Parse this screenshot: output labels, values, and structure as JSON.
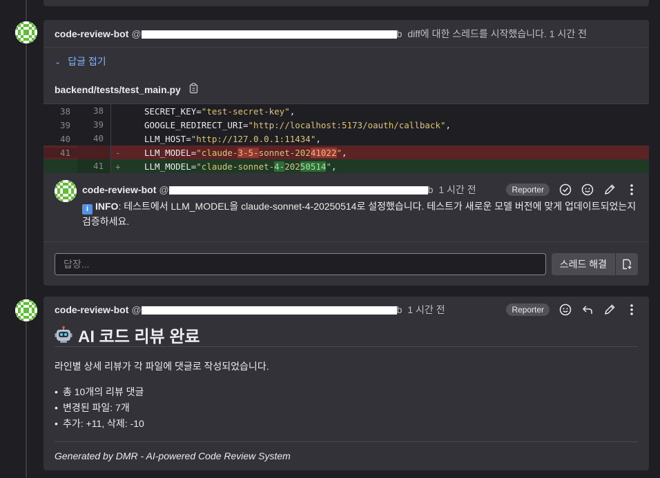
{
  "thread": {
    "author": "code-review-bot",
    "handle_prefix": "@",
    "handle_suffix": "b",
    "action": "diff에 대한 스레드를 시작했습니다.",
    "time": "1 시간 전",
    "collapse_label": "답글 접기",
    "file_path": "backend/tests/test_main.py"
  },
  "diff": {
    "lines": [
      {
        "old": "38",
        "new": "38",
        "sign": "",
        "type": "ctx",
        "key": "SECRET_KEY=",
        "str": "\"test-secret-key\"",
        "tail": ","
      },
      {
        "old": "39",
        "new": "39",
        "sign": "",
        "type": "ctx",
        "key": "GOOGLE_REDIRECT_URI=",
        "str": "\"http://localhost:5173/oauth/callback\"",
        "tail": ","
      },
      {
        "old": "40",
        "new": "40",
        "sign": "",
        "type": "ctx",
        "key": "LLM_HOST=",
        "str": "\"http://127.0.0.1:11434\"",
        "tail": ","
      }
    ],
    "del_line": {
      "old": "41",
      "sign": "-",
      "key": "LLM_MODEL=",
      "p1": "\"claude-",
      "h1": "3-5-",
      "p2": "sonnet-202",
      "h2": "41022",
      "p3": "\"",
      "tail": ","
    },
    "add_line": {
      "new": "41",
      "sign": "+",
      "key": "LLM_MODEL=",
      "p1": "\"claude-sonnet-",
      "h1": "4-",
      "p2": "202",
      "h2": "50514",
      "p3": "\"",
      "tail": ","
    }
  },
  "note": {
    "author": "code-review-bot",
    "handle_prefix": "@",
    "handle_suffix": "b",
    "time": "1 시간 전",
    "badge": "Reporter",
    "info_label": "INFO",
    "body": ": 테스트에서 LLM_MODEL을 claude-sonnet-4-20250514로 설정했습니다. 테스트가 새로운 모델 버전에 맞게 업데이트되었는지 검증하세요."
  },
  "reply": {
    "placeholder": "답장...",
    "resolve_label": "스레드 해결"
  },
  "summary": {
    "author": "code-review-bot",
    "handle_prefix": "@",
    "handle_suffix": "b",
    "time": "1 시간 전",
    "badge": "Reporter",
    "title": "AI 코드 리뷰 완료",
    "intro": "라인별 상세 리뷰가 각 파일에 댓글로 작성되었습니다.",
    "items": [
      "총 10개의 리뷰 댓글",
      "변경된 파일: 7개",
      "추가: +11, 삭제: -10"
    ],
    "footer": "Generated by DMR - AI-powered Code Review System"
  },
  "icons": {
    "avatar": "identicon-avatar",
    "copy": "copy-icon",
    "check": "check-circle-icon",
    "emoji": "smiley-icon",
    "edit": "pencil-icon",
    "more": "kebab-icon",
    "reply": "reply-arrow-icon",
    "robot": "robot-icon"
  }
}
